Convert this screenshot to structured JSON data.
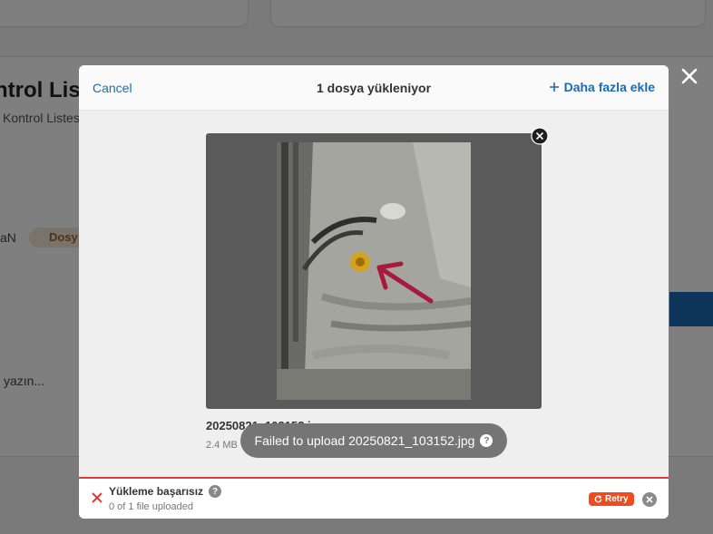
{
  "background": {
    "title_fragment": "ntrol Liste",
    "subtitle_fragment": "Kontrol Listes",
    "label_fragment": "aN",
    "badge_fragment": "Dosy",
    "placeholder_fragment": "yazın..."
  },
  "modal": {
    "cancel_label": "Cancel",
    "title": "1 dosya yükleniyor",
    "add_more_label": "Daha fazla ekle",
    "file": {
      "name": "20250821_103152.j",
      "size": "2.4 MB"
    },
    "toast": "Failed to upload 20250821_103152.jpg",
    "status": {
      "title": "Yükleme başarısız",
      "subtitle": "0 of 1 file uploaded",
      "retry_label": "Retry"
    }
  },
  "colors": {
    "accent": "#1b6bb4",
    "error": "#e03a3a",
    "retry": "#ef4b1f"
  }
}
